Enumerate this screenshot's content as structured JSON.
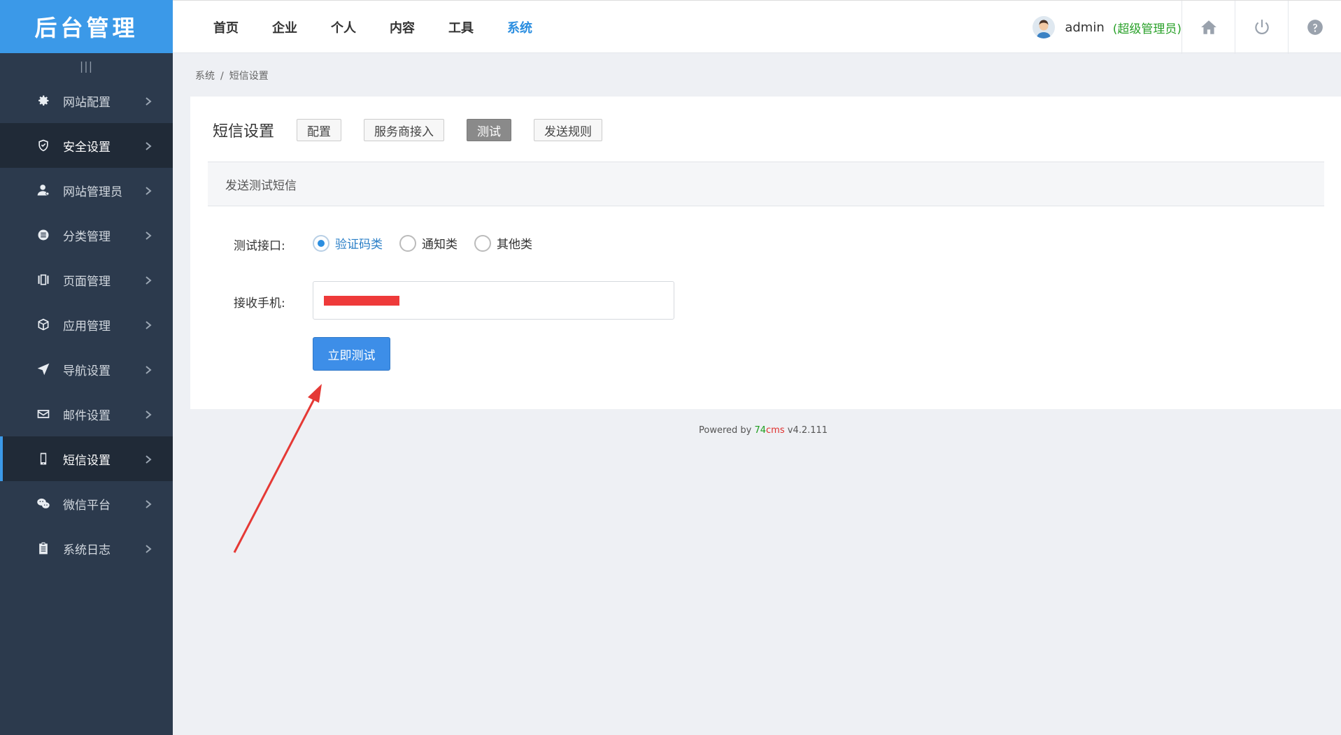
{
  "sidebar": {
    "logo": "后台管理",
    "collapse_icon": "|||",
    "items": [
      {
        "label": "网站配置",
        "icon": "gear-icon"
      },
      {
        "label": "安全设置",
        "icon": "shield-icon"
      },
      {
        "label": "网站管理员",
        "icon": "user-icon"
      },
      {
        "label": "分类管理",
        "icon": "list-icon"
      },
      {
        "label": "页面管理",
        "icon": "pages-icon"
      },
      {
        "label": "应用管理",
        "icon": "cube-icon"
      },
      {
        "label": "导航设置",
        "icon": "navigation-icon"
      },
      {
        "label": "邮件设置",
        "icon": "mail-icon"
      },
      {
        "label": "短信设置",
        "icon": "phone-icon"
      },
      {
        "label": "微信平台",
        "icon": "wechat-icon"
      },
      {
        "label": "系统日志",
        "icon": "clipboard-icon"
      }
    ]
  },
  "topnav": {
    "items": [
      "首页",
      "企业",
      "个人",
      "内容",
      "工具",
      "系统"
    ],
    "active": "系统"
  },
  "user": {
    "name": "admin",
    "role": "(超级管理员)"
  },
  "breadcrumb": {
    "parent": "系统",
    "separator": "/",
    "current": "短信设置"
  },
  "card": {
    "title": "短信设置",
    "tabs": [
      "配置",
      "服务商接入",
      "测试",
      "发送规则"
    ],
    "active_tab": "测试",
    "section_title": "发送测试短信",
    "interface_label": "测试接口:",
    "radios": [
      "验证码类",
      "通知类",
      "其他类"
    ],
    "radio_selected": "验证码类",
    "phone_label": "接收手机:",
    "submit_label": "立即测试"
  },
  "footer": {
    "prefix": "Powered by ",
    "brand_a": "74",
    "brand_b": "cms",
    "version": " v4.2.111"
  },
  "colors": {
    "sidebar": "#2c3a4d",
    "logo_bg": "#3b99e8",
    "accent": "#2b8ee0",
    "button": "#3d8ee8",
    "annotation_arrow": "#e53935"
  }
}
